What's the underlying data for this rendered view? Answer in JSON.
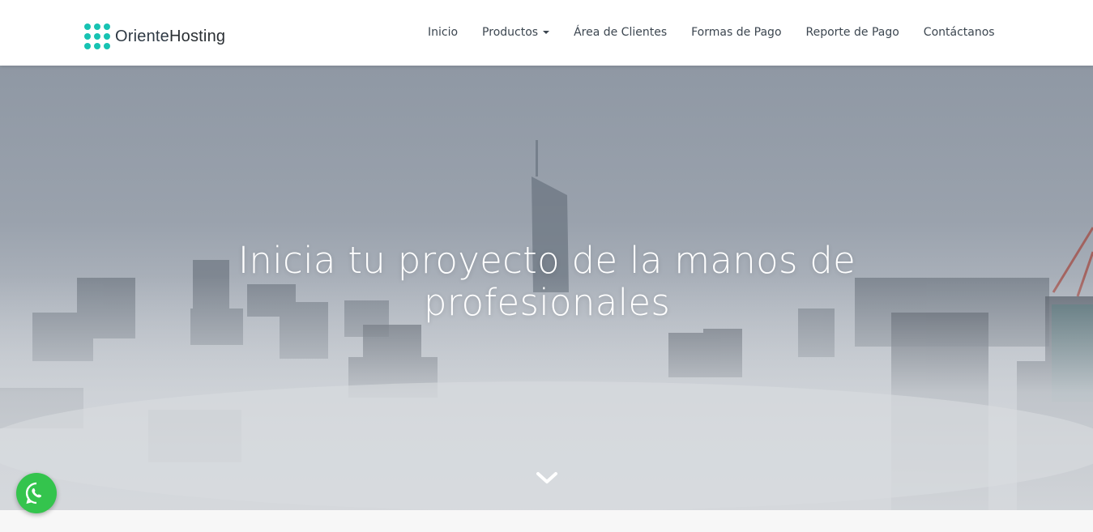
{
  "brand": {
    "name_part1": "Oriente",
    "name_part2": "Hosting",
    "accent_color": "#17c3b2"
  },
  "nav": {
    "items": [
      {
        "label": "Inicio"
      },
      {
        "label": "Productos",
        "has_dropdown": true
      },
      {
        "label": "Área de Clientes"
      },
      {
        "label": "Formas de Pago"
      },
      {
        "label": "Reporte de Pago"
      },
      {
        "label": "Contáctanos"
      }
    ]
  },
  "hero": {
    "title": "Inicia tu proyecto de la manos de profesionales",
    "scroll_icon": "chevron-down-icon"
  },
  "floating": {
    "whatsapp_icon": "whatsapp-icon",
    "whatsapp_color": "#34c44d"
  }
}
